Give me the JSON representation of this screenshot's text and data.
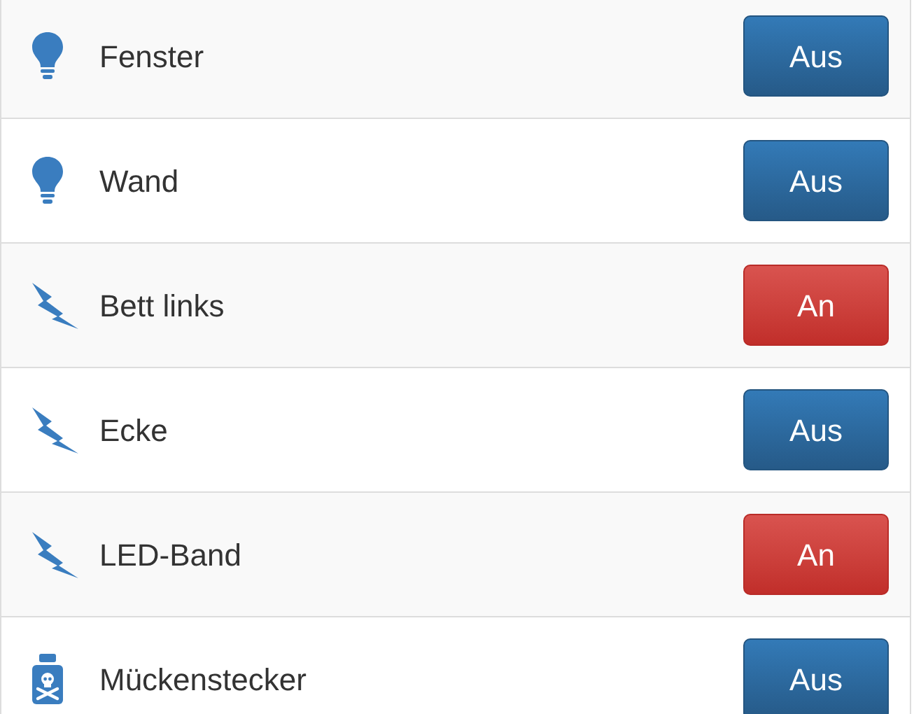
{
  "devices": [
    {
      "kind": "bulb",
      "name": "Fenster",
      "on": false,
      "button": "Aus"
    },
    {
      "kind": "bulb",
      "name": "Wand",
      "on": false,
      "button": "Aus"
    },
    {
      "kind": "bolt",
      "name": "Bett links",
      "on": true,
      "button": "An"
    },
    {
      "kind": "bolt",
      "name": "Ecke",
      "on": false,
      "button": "Aus"
    },
    {
      "kind": "bolt",
      "name": "LED-Band",
      "on": true,
      "button": "An"
    },
    {
      "kind": "poison",
      "name": "Mückenstecker",
      "on": false,
      "button": "Aus"
    }
  ]
}
